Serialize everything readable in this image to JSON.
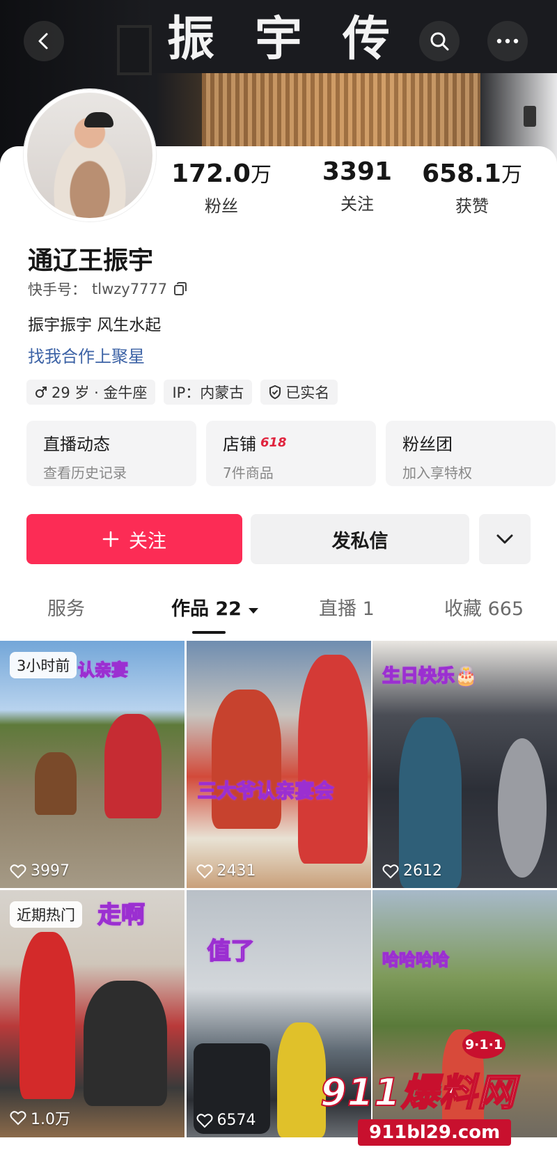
{
  "banner": {
    "sign_text": "振宇传"
  },
  "profile": {
    "name": "通辽王振宇",
    "uid_label": "快手号：",
    "uid_value": "tlwzy7777",
    "bio": "振宇振宇 风生水起",
    "coop_link": "找我合作上聚星"
  },
  "stats": [
    {
      "num": "172.0",
      "unit": "万",
      "label": "粉丝"
    },
    {
      "num": "3391",
      "unit": "",
      "label": "关注"
    },
    {
      "num": "658.1",
      "unit": "万",
      "label": "获赞"
    }
  ],
  "tags": {
    "age": "29 岁 · 金牛座",
    "ip": "IP：内蒙古",
    "verified": "已实名"
  },
  "tiles": [
    {
      "title": "直播动态",
      "badge": "",
      "sub": "查看历史记录"
    },
    {
      "title": "店铺",
      "badge": "618",
      "sub": "7件商品"
    },
    {
      "title": "粉丝团",
      "badge": "",
      "sub": "加入享特权"
    }
  ],
  "actions": {
    "follow": "关注",
    "message": "发私信"
  },
  "tabs": [
    {
      "label": "服务"
    },
    {
      "label": "作品 22"
    },
    {
      "label": "直播 1"
    },
    {
      "label": "收藏 665"
    }
  ],
  "videos": [
    {
      "tag": "3小时前",
      "caption": "认亲宴",
      "likes": "3997"
    },
    {
      "tag": "",
      "caption": "三大爷认亲宴会",
      "likes": "2431"
    },
    {
      "tag": "",
      "caption": "生日快乐🎂",
      "likes": "2612"
    },
    {
      "tag": "近期热门",
      "caption": "走啊",
      "likes": "1.0万"
    },
    {
      "tag": "",
      "caption": "值了",
      "likes": "6574"
    },
    {
      "tag": "",
      "caption": "哈哈哈哈",
      "likes": ""
    }
  ],
  "watermark": {
    "brand": "911爆料网",
    "badge": "9·1·1",
    "url": "911bl29.com"
  },
  "icons": [
    "back-icon",
    "search-icon",
    "more-icon",
    "copy-icon",
    "male-icon",
    "shield-icon",
    "plus-icon",
    "chevron-down-icon",
    "heart-icon"
  ],
  "colors": {
    "accent": "#fc2c55",
    "link": "#3d63a6",
    "badge": "#e0243e"
  }
}
